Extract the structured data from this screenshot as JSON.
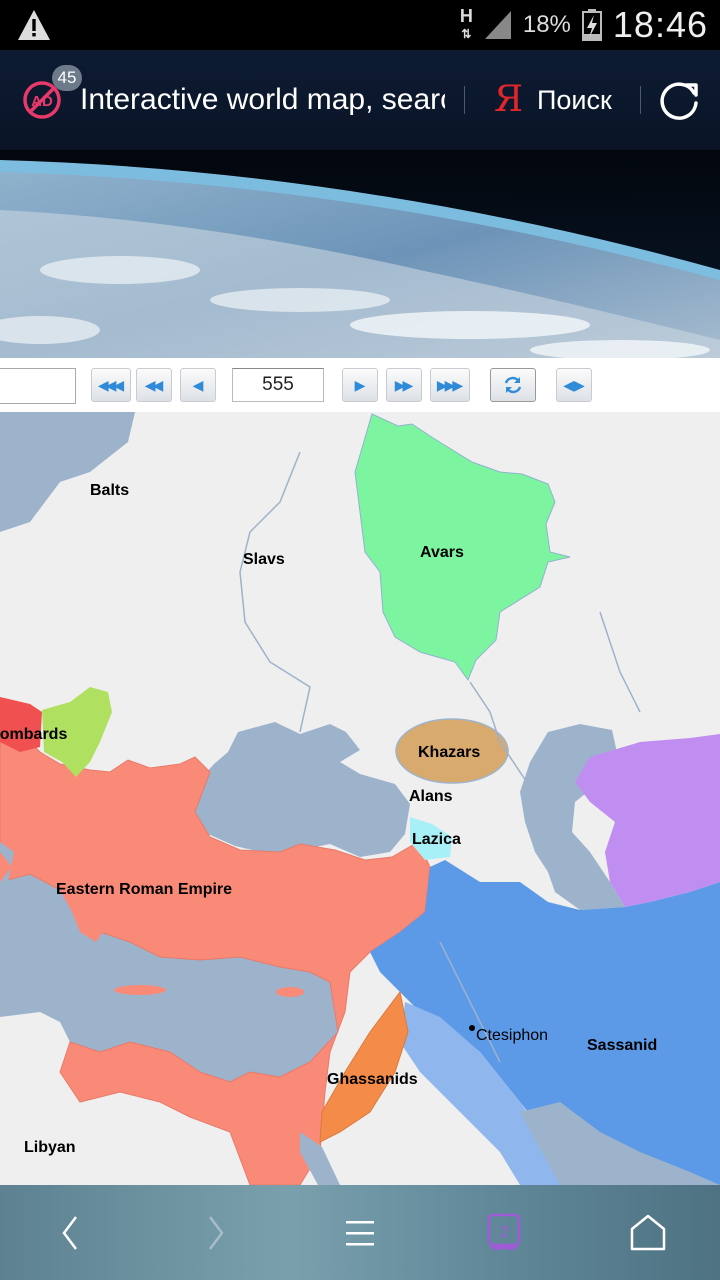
{
  "status_bar": {
    "network": "H",
    "battery": "18%",
    "time": "18:46"
  },
  "browser": {
    "ad_blocked_count": "45",
    "page_title": "Interactive world map, search",
    "search_engine_logo": "Я",
    "search_label": "Поиск"
  },
  "toolbar": {
    "year": "555"
  },
  "map_labels": {
    "balts": "Balts",
    "slavs": "Slavs",
    "avars": "Avars",
    "lombards": "Lombards",
    "khazars": "Khazars",
    "alans": "Alans",
    "lazica": "Lazica",
    "eastern_roman": "Eastern Roman Empire",
    "ctesiphon": "Ctesiphon",
    "sassanid": "Sassanid",
    "ghassanids": "Ghassanids",
    "libyan": "Libyan"
  },
  "colors": {
    "eastern_roman": "#f98a78",
    "sassanid": "#5c9ae8",
    "avars": "#7df5a0",
    "khazars": "#d9aa6e",
    "lazica": "#a8f0f8",
    "ghassanids": "#f58b48",
    "lombards": "#f05050",
    "gepids": "#b0e060",
    "purple_region": "#c08ef0",
    "water": "#9db3cc",
    "land": "#efefef"
  },
  "bottom_nav": {
    "tab_count": "2"
  }
}
